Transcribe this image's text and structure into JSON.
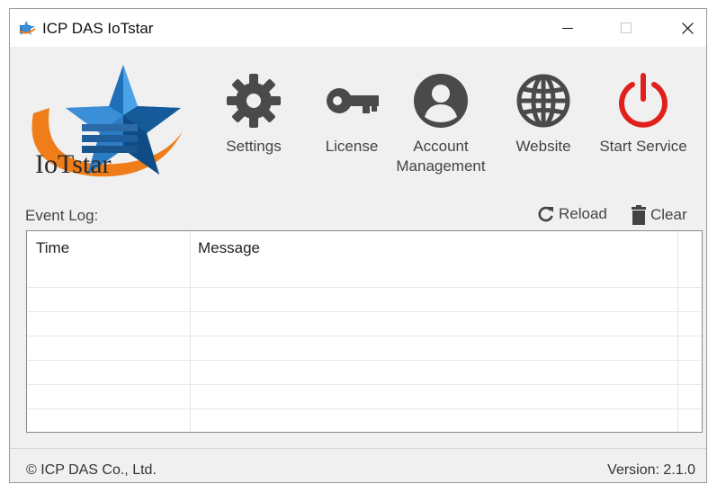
{
  "titlebar": {
    "title": "ICP DAS IoTstar",
    "minimize_glyph": "—",
    "maximize_glyph": "☐",
    "close_glyph": "✕"
  },
  "logo": {
    "text": "IoTstar"
  },
  "toolbar": {
    "settings_label": "Settings",
    "license_label": "License",
    "account_label_line1": "Account",
    "account_label_line2": "Management",
    "website_label": "Website",
    "start_service_label": "Start Service"
  },
  "eventlog": {
    "label": "Event Log:",
    "reload_label": "Reload",
    "clear_label": "Clear",
    "columns": [
      "Time",
      "Message"
    ],
    "rows": []
  },
  "status": {
    "copyright": "© ICP DAS Co., Ltd.",
    "version": "Version: 2.1.0"
  },
  "colors": {
    "icon_gray": "#4a4a4a",
    "power_red": "#e0201b",
    "logo_blue": "#1f6fb8",
    "logo_orange": "#ef7d1a"
  },
  "icons": {
    "settings": "gear-icon",
    "license": "key-icon",
    "account": "user-icon",
    "website": "globe-icon",
    "start_service": "power-icon",
    "reload": "reload-icon",
    "clear": "trash-icon"
  }
}
